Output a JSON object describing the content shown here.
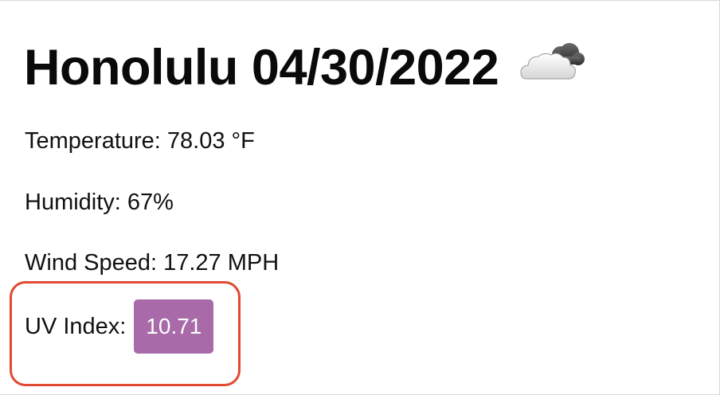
{
  "weather": {
    "title": "Honolulu 04/30/2022",
    "icon": "partly-cloudy-icon",
    "temperature": "Temperature: 78.03 °F",
    "humidity": "Humidity: 67%",
    "wind_speed": "Wind Speed: 17.27 MPH",
    "uv_label": "UV Index:",
    "uv_value": "10.71"
  },
  "colors": {
    "uv_badge": "#a86aa8",
    "highlight": "#e04a32"
  }
}
